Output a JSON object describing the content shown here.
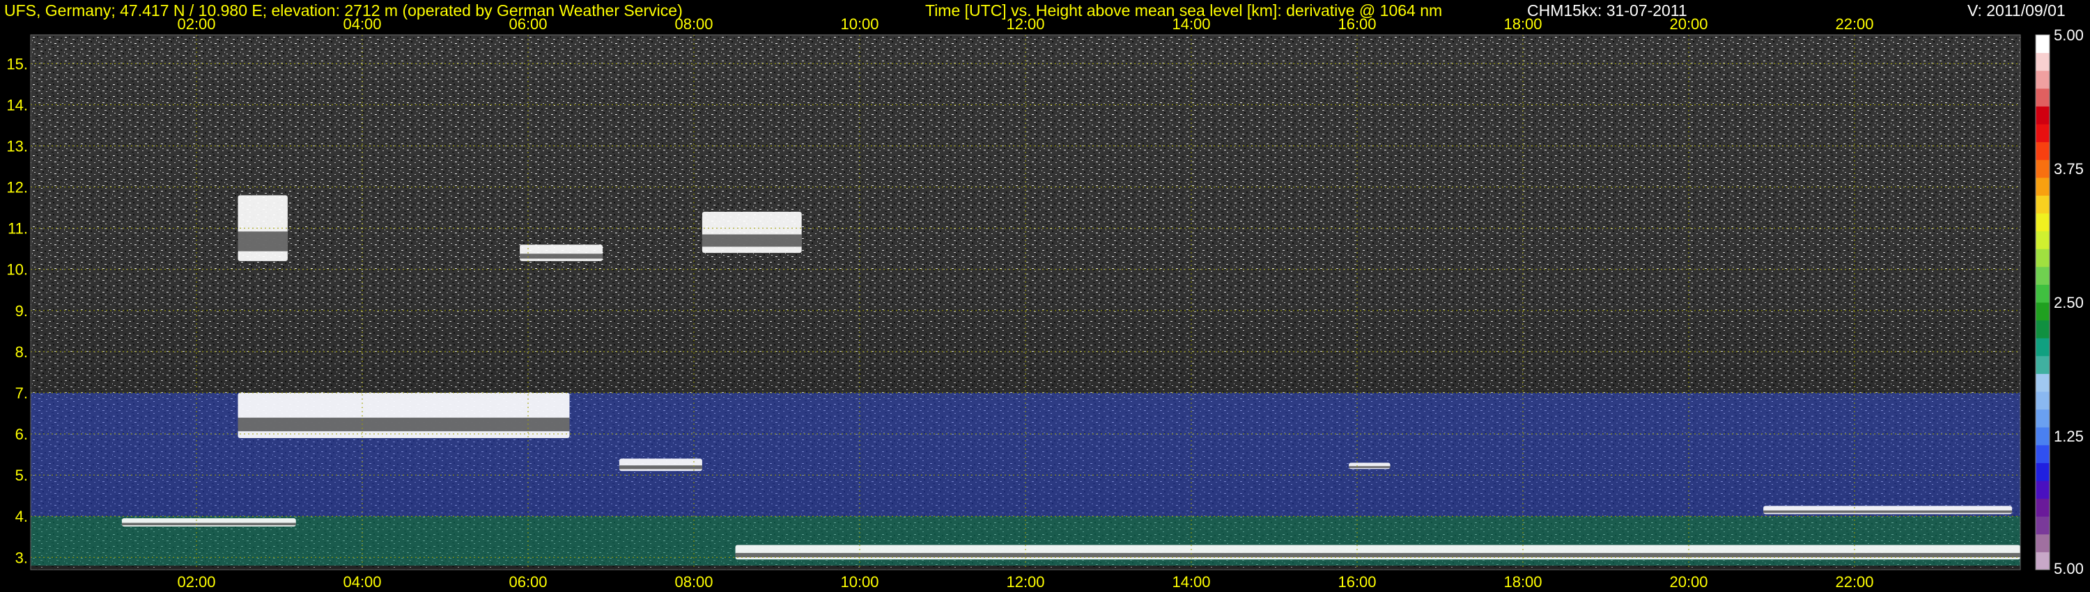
{
  "header": {
    "location": "UFS, Germany; 47.417 N / 10.980 E; elevation: 2712 m  (operated by German Weather Service)",
    "title": "Time [UTC] vs. Height above mean sea level [km]: derivative @ 1064 nm",
    "instrument": "CHM15kx: 31-07-2011",
    "version": "V: 2011/09/01"
  },
  "colors": {
    "background": "#000000",
    "text_accent": "#ffff00",
    "grid": "#a0a000",
    "cloud_echo": "#ffffff"
  },
  "chart_data": {
    "type": "heatmap",
    "xlabel": "Time [UTC]",
    "ylabel": "Height above mean sea level [km]",
    "x_ticks": [
      "02:00",
      "04:00",
      "06:00",
      "08:00",
      "10:00",
      "12:00",
      "14:00",
      "16:00",
      "18:00",
      "20:00",
      "22:00"
    ],
    "x_tick_hours": [
      2,
      4,
      6,
      8,
      10,
      12,
      14,
      16,
      18,
      20,
      22
    ],
    "xlim_hours": [
      0,
      24
    ],
    "y_ticks": [
      "3.",
      "4.",
      "5.",
      "6.",
      "7.",
      "8.",
      "9.",
      "10.",
      "11.",
      "12.",
      "13.",
      "14.",
      "15."
    ],
    "y_tick_values": [
      3,
      4,
      5,
      6,
      7,
      8,
      9,
      10,
      11,
      12,
      13,
      14,
      15
    ],
    "ylim_km": [
      2.7,
      15.7
    ],
    "grid": true,
    "colorbar": {
      "placement": "right",
      "ticks": [
        "5.00",
        "3.75",
        "2.50",
        "1.25",
        "5.00"
      ],
      "tick_values": [
        5.0,
        3.75,
        2.5,
        1.25,
        0.0
      ],
      "range": [
        0,
        5
      ],
      "colors": [
        "#c8a8c8",
        "#a070a0",
        "#7a3a9a",
        "#6a1a9a",
        "#4a10c0",
        "#2020e0",
        "#3050f0",
        "#4a80f0",
        "#6aa0f0",
        "#8ab8f0",
        "#a0c8f0",
        "#40b0a0",
        "#10a080",
        "#109040",
        "#20a020",
        "#40c040",
        "#70d050",
        "#a0e040",
        "#d0f030",
        "#f0f020",
        "#f8d020",
        "#f8a010",
        "#f87010",
        "#f84010",
        "#e81010",
        "#d00010",
        "#e06060",
        "#f0a0a0",
        "#f8d0d0",
        "#ffffff"
      ]
    },
    "layers": [
      {
        "name": "surface aerosol",
        "t_start": 0.0,
        "t_end": 24.0,
        "h_base": 2.8,
        "h_top": 4.0,
        "intensity": 2.0
      },
      {
        "name": "residual aerosol",
        "t_start": 0.0,
        "t_end": 24.0,
        "h_base": 4.0,
        "h_top": 7.0,
        "intensity": 1.0
      },
      {
        "name": "cloud",
        "t_start": 1.1,
        "t_end": 3.2,
        "h_base": 3.75,
        "h_top": 3.95,
        "intensity": 5.0
      },
      {
        "name": "cloud",
        "t_start": 2.5,
        "t_end": 6.5,
        "h_base": 5.9,
        "h_top": 7.0,
        "intensity": 5.0
      },
      {
        "name": "cloud",
        "t_start": 2.5,
        "t_end": 3.1,
        "h_base": 10.2,
        "h_top": 11.8,
        "intensity": 5.0
      },
      {
        "name": "cloud",
        "t_start": 5.9,
        "t_end": 6.9,
        "h_base": 10.2,
        "h_top": 10.6,
        "intensity": 5.0
      },
      {
        "name": "cloud",
        "t_start": 7.1,
        "t_end": 8.1,
        "h_base": 5.1,
        "h_top": 5.4,
        "intensity": 5.0
      },
      {
        "name": "cloud",
        "t_start": 8.1,
        "t_end": 9.3,
        "h_base": 10.4,
        "h_top": 11.4,
        "intensity": 5.0
      },
      {
        "name": "cloud",
        "t_start": 15.9,
        "t_end": 16.4,
        "h_base": 5.15,
        "h_top": 5.3,
        "intensity": 5.0
      },
      {
        "name": "cloud",
        "t_start": 20.9,
        "t_end": 23.9,
        "h_base": 4.05,
        "h_top": 4.25,
        "intensity": 5.0
      },
      {
        "name": "boundary layer top",
        "t_start": 8.5,
        "t_end": 24.0,
        "h_base": 2.95,
        "h_top": 3.3,
        "intensity": 5.0
      }
    ]
  }
}
